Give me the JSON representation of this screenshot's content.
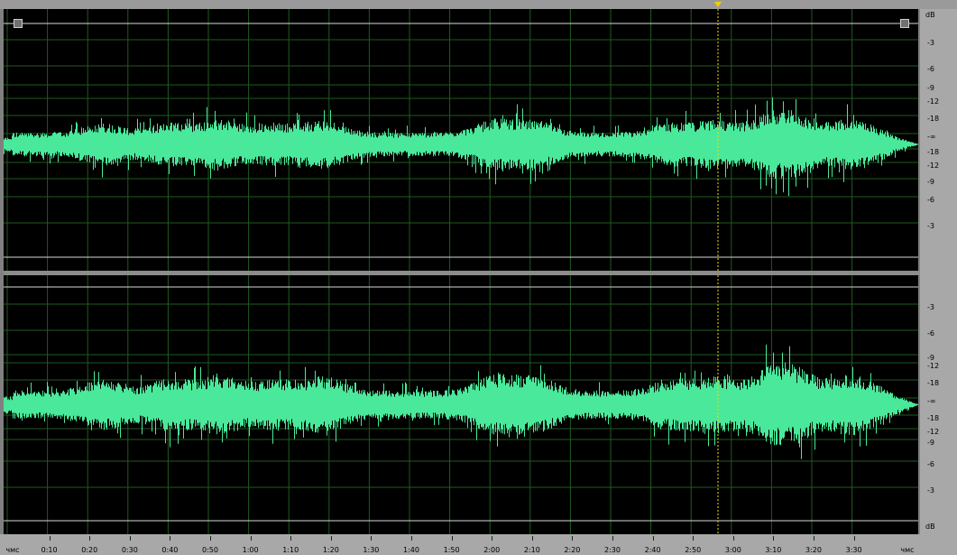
{
  "colors": {
    "waveform": "#4ae89a",
    "background": "#000000",
    "grid": "#1f5a1f",
    "playhead": "#f0e000"
  },
  "db_scale": {
    "top_unit": "dB",
    "bottom_unit": "dB",
    "ch1": [
      "-3",
      "-6",
      "-9",
      "-12",
      "-18",
      "-∞",
      "-18",
      "-12",
      "-9",
      "-6",
      "-3"
    ],
    "ch2": [
      "-3",
      "-6",
      "-9",
      "-12",
      "-18",
      "-∞",
      "-18",
      "-12",
      "-9",
      "-6",
      "-3"
    ]
  },
  "timeline": {
    "start_label": "чмс",
    "end_label": "чмс",
    "ticks": [
      "0:10",
      "0:20",
      "0:30",
      "0:40",
      "0:50",
      "1:00",
      "1:10",
      "1:20",
      "1:30",
      "1:40",
      "1:50",
      "2:00",
      "2:10",
      "2:20",
      "2:30",
      "2:40",
      "2:50",
      "3:00",
      "3:10",
      "3:20",
      "3:30"
    ]
  }
}
